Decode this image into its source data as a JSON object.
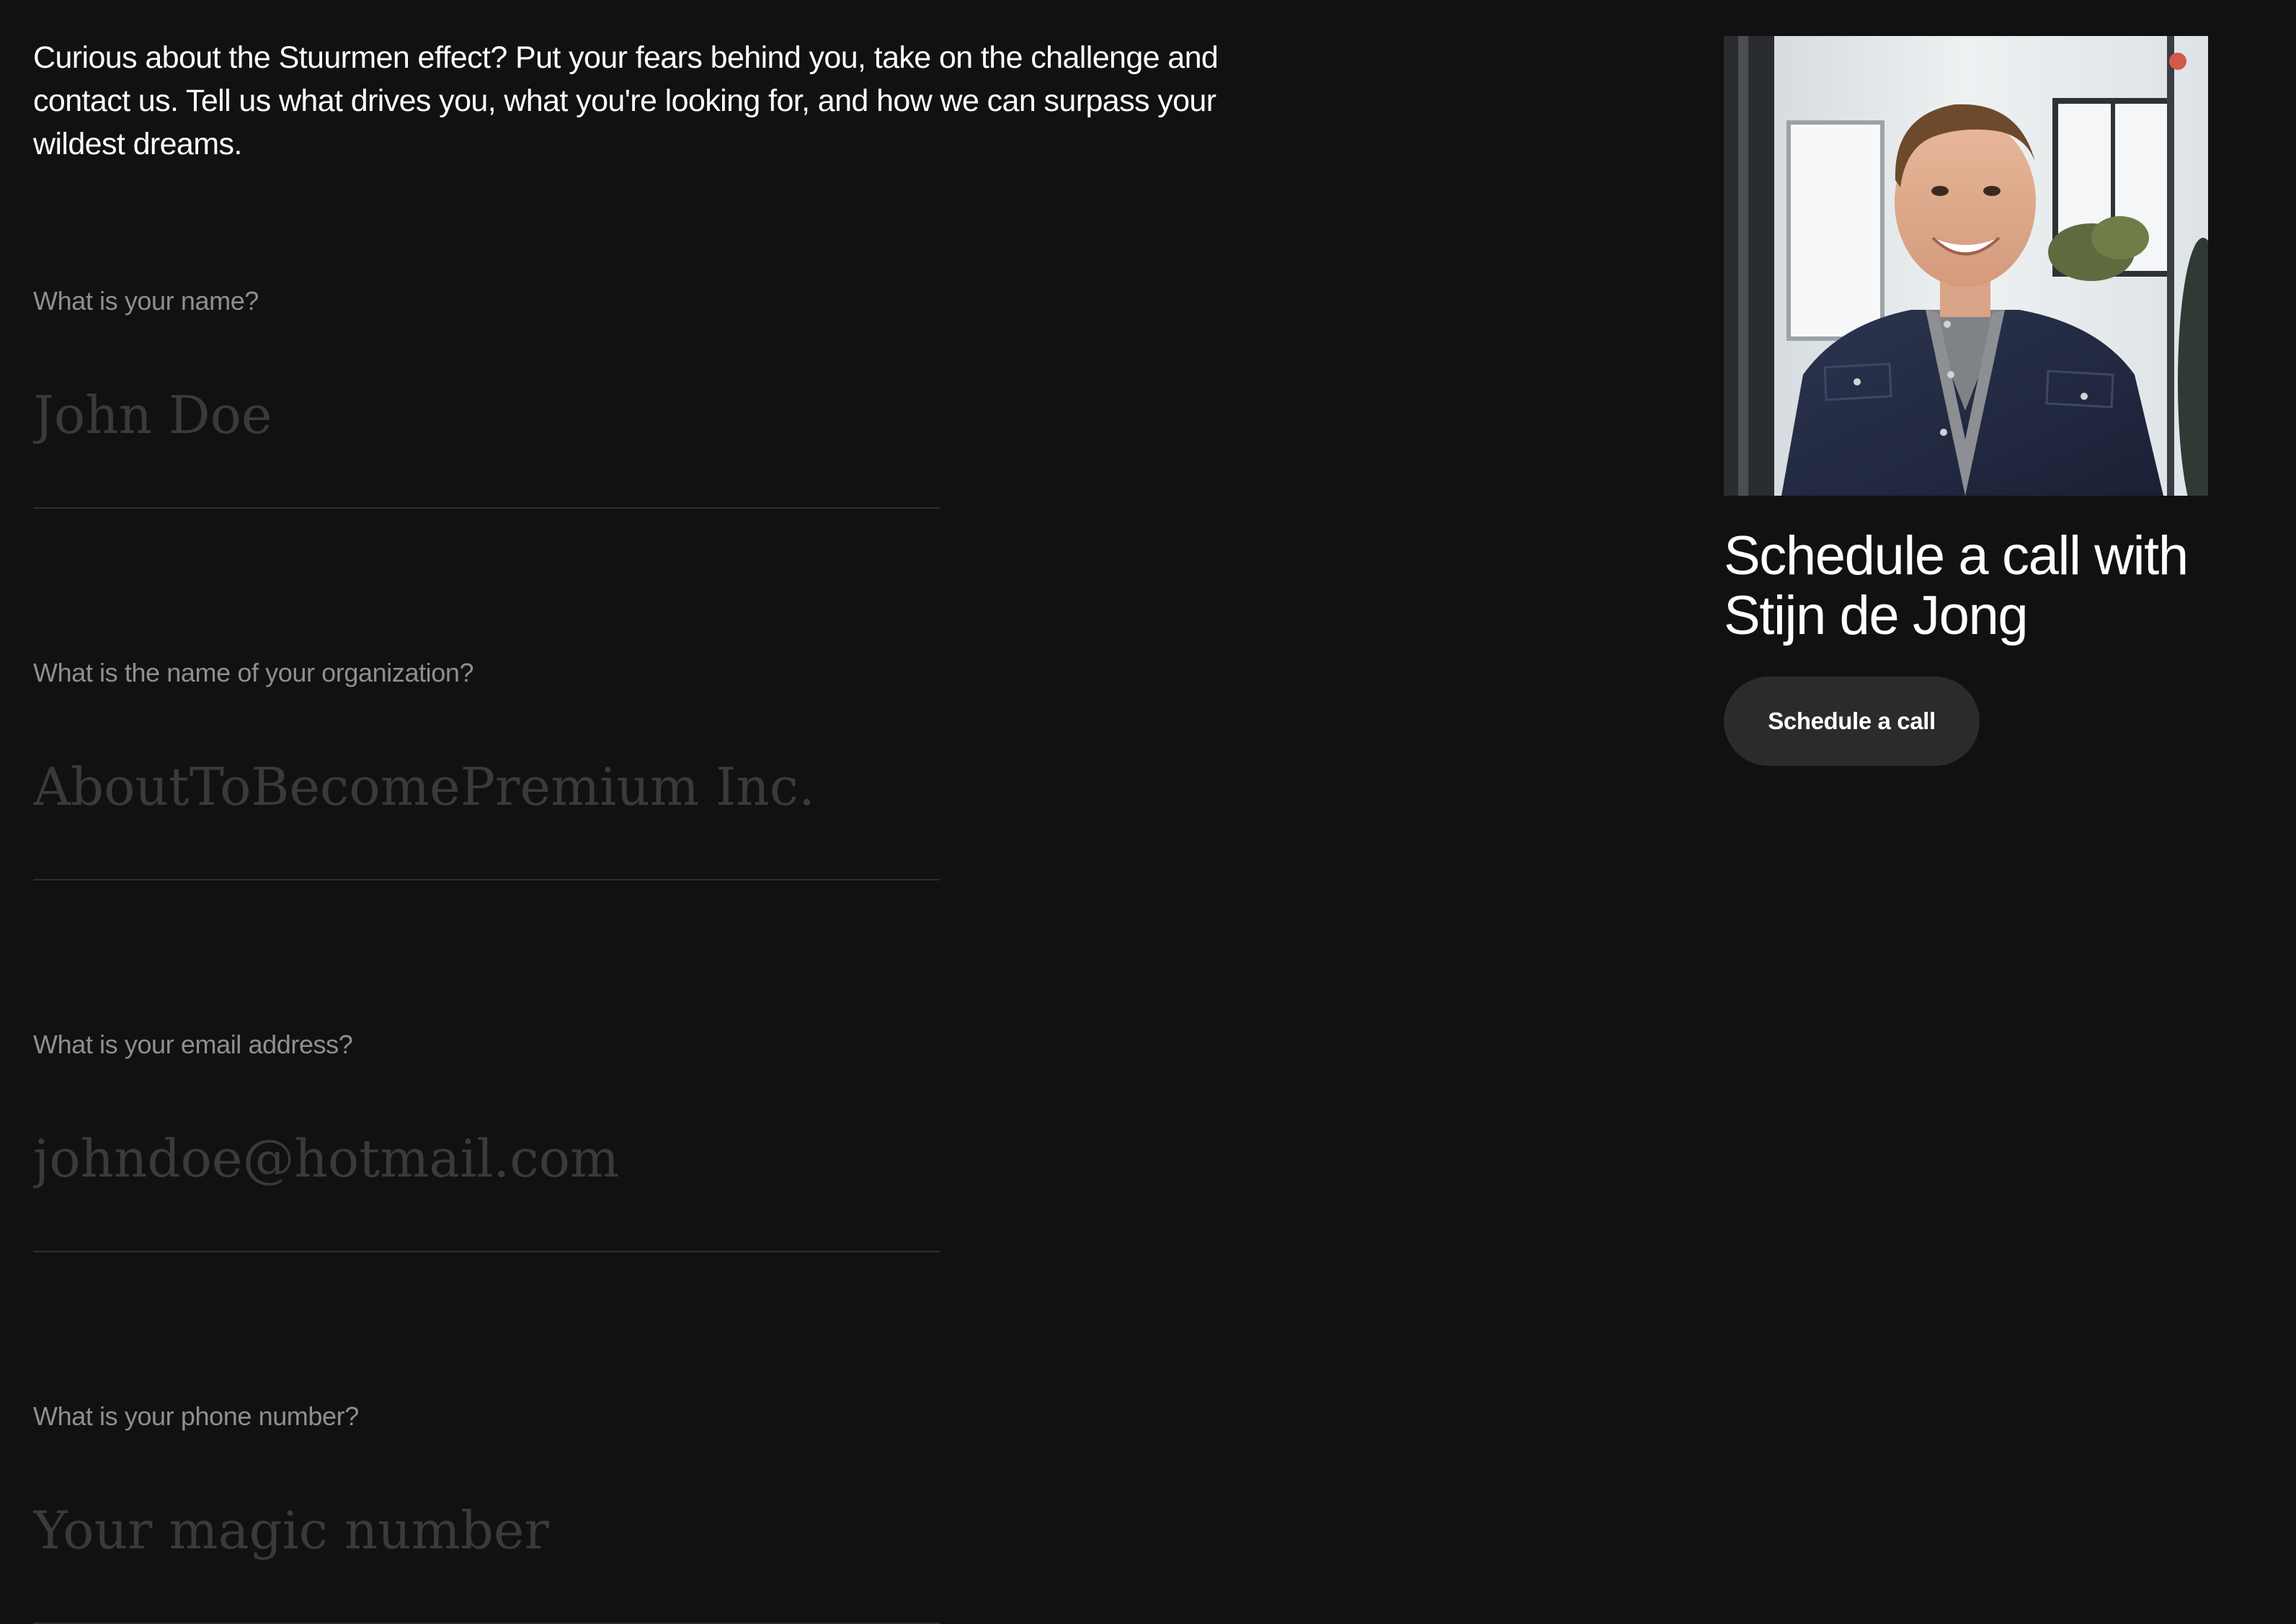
{
  "intro": {
    "text": "Curious about the Stuurmen effect? Put your fears behind you, take on the challenge and contact us. Tell us what drives you, what you're looking for, and how we can surpass your wildest dreams."
  },
  "form": {
    "fields": [
      {
        "label": "What is your name?",
        "placeholder": "John Doe",
        "value": ""
      },
      {
        "label": "What is the name of your organization?",
        "placeholder": "AboutToBecomePremium Inc.",
        "value": ""
      },
      {
        "label": "What is your email address?",
        "placeholder": "johndoe@hotmail.com",
        "value": ""
      },
      {
        "label": "What is your phone number?",
        "placeholder": "Your magic number",
        "value": ""
      }
    ]
  },
  "contact": {
    "title": "Schedule a call with Stijn de Jong",
    "button_label": "Schedule a call"
  },
  "colors": {
    "background": "#111111",
    "text": "#ffffff",
    "label": "#8f8f8f",
    "placeholder": "#3a3a3a",
    "underline": "#2e2e2e",
    "button_background": "#2b2b2b"
  }
}
